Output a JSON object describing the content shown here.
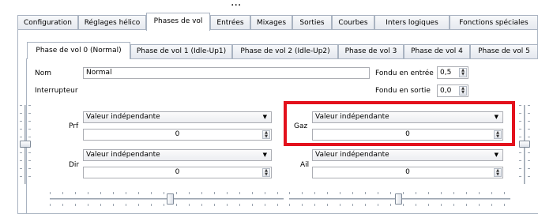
{
  "top_fragment": "...",
  "main_tabs": [
    "Configuration",
    "Réglages hélico",
    "Phases de vol",
    "Entrées",
    "Mixages",
    "Sorties",
    "Courbes",
    "Inters logiques",
    "Fonctions spéciales"
  ],
  "sub_tabs": [
    "Phase de vol 0 (Normal)",
    "Phase de vol 1 (Idle-Up1)",
    "Phase de vol 2 (Idle-Up2)",
    "Phase de vol 3",
    "Phase de vol 4",
    "Phase de vol 5"
  ],
  "form": {
    "name_label": "Nom",
    "name_value": "Normal",
    "switch_label": "Interrupteur",
    "fade_in_label": "Fondu en entrée",
    "fade_in_value": "0,5",
    "fade_out_label": "Fondu en sortie",
    "fade_out_value": "0,0"
  },
  "trims": [
    {
      "label": "Prf",
      "mode": "Valeur indépendante",
      "value": "0"
    },
    {
      "label": "Gaz",
      "mode": "Valeur indépendante",
      "value": "0"
    },
    {
      "label": "Dir",
      "mode": "Valeur indépendante",
      "value": "0"
    },
    {
      "label": "Ail",
      "mode": "Valeur indépendante",
      "value": "0"
    }
  ],
  "sliders": {
    "left_vertical_level": 0.5,
    "right_vertical_level": 0.5,
    "left_horizontal_level": 0.5,
    "right_horizontal_level": 0.5
  },
  "colors": {
    "highlight": "#e3111c",
    "border": "#a9b3c1"
  },
  "icons": {
    "spin": "spin-arrows-icon",
    "dropdown": "chevron-down-icon"
  }
}
